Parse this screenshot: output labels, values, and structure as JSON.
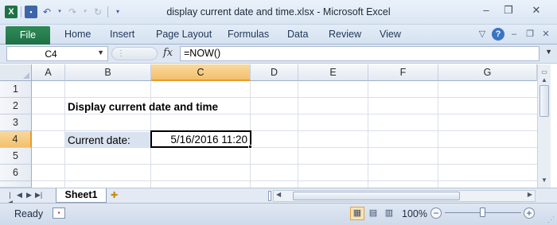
{
  "window": {
    "title": "display current date and time.xlsx - Microsoft Excel",
    "minimize": "–",
    "restore": "❐",
    "close": "✕"
  },
  "ribbon": {
    "file_tab": "File",
    "tabs": [
      "Home",
      "Insert",
      "Page Layout",
      "Formulas",
      "Data",
      "Review",
      "View"
    ]
  },
  "formula_bar": {
    "name_box": "C4",
    "fx": "fx",
    "formula": "=NOW()"
  },
  "grid": {
    "columns": [
      "A",
      "B",
      "C",
      "D",
      "E",
      "F",
      "G"
    ],
    "rows": [
      "1",
      "2",
      "3",
      "4",
      "5",
      "6"
    ],
    "selected_column": "C",
    "selected_row": "4",
    "cells": {
      "B2": "Display current date and time",
      "B4": "Current date:",
      "C4": "5/16/2016 11:20"
    },
    "label_fill_color": "#d9e3f0",
    "selection_header_color": "#f3c06b"
  },
  "sheets": {
    "active": "Sheet1"
  },
  "status": {
    "ready": "Ready",
    "zoom": "100%"
  }
}
